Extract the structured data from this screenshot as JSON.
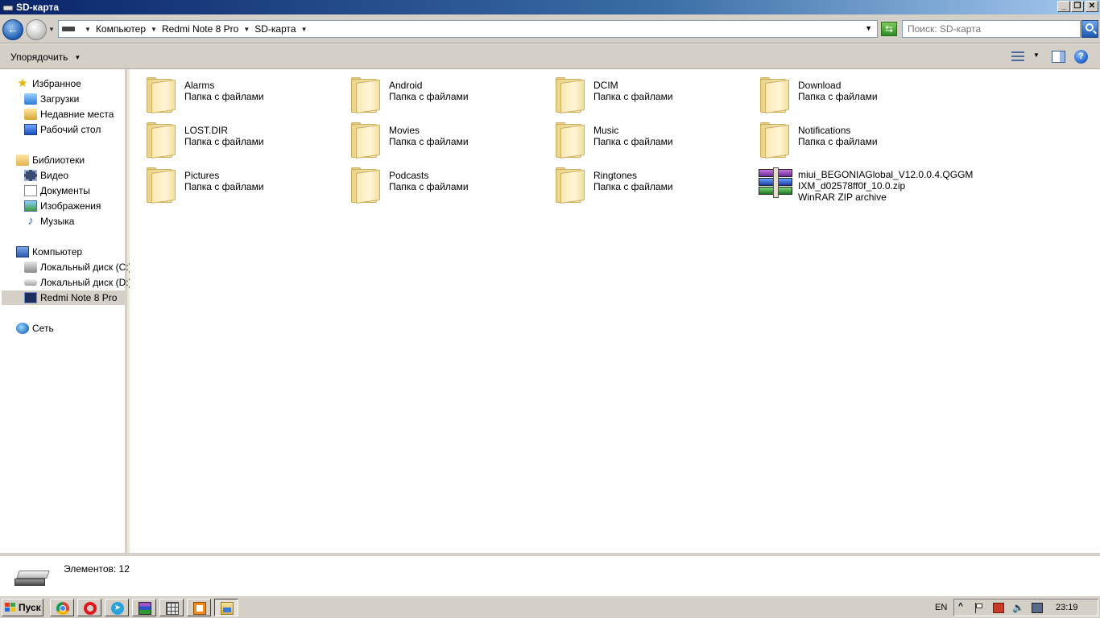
{
  "window": {
    "title": "SD-карта",
    "controls": {
      "minimize": "_",
      "restore": "❐",
      "close": "✕"
    }
  },
  "address": {
    "breadcrumbs": [
      "Компьютер",
      "Redmi Note 8 Pro",
      "SD-карта"
    ],
    "search_placeholder": "Поиск: SD-карта"
  },
  "toolbar": {
    "organize_label": "Упорядочить",
    "help_glyph": "?"
  },
  "sidebar": {
    "favorites": {
      "label": "Избранное",
      "items": [
        "Загрузки",
        "Недавние места",
        "Рабочий стол"
      ]
    },
    "libraries": {
      "label": "Библиотеки",
      "items": [
        "Видео",
        "Документы",
        "Изображения",
        "Музыка"
      ]
    },
    "computer": {
      "label": "Компьютер",
      "items": [
        "Локальный диск (C:)",
        "Локальный диск (D:)",
        "Redmi Note 8 Pro"
      ],
      "selected": "Redmi Note 8 Pro"
    },
    "network": {
      "label": "Сеть"
    }
  },
  "items": [
    {
      "name": "Alarms",
      "type": "Папка с файлами"
    },
    {
      "name": "Android",
      "type": "Папка с файлами"
    },
    {
      "name": "DCIM",
      "type": "Папка с файлами"
    },
    {
      "name": "Download",
      "type": "Папка с файлами"
    },
    {
      "name": "LOST.DIR",
      "type": "Папка с файлами"
    },
    {
      "name": "Movies",
      "type": "Папка с файлами"
    },
    {
      "name": "Music",
      "type": "Папка с файлами"
    },
    {
      "name": "Notifications",
      "type": "Папка с файлами"
    },
    {
      "name": "Pictures",
      "type": "Папка с файлами"
    },
    {
      "name": "Podcasts",
      "type": "Папка с файлами"
    },
    {
      "name": "Ringtones",
      "type": "Папка с файлами"
    },
    {
      "name_line1": "miui_BEGONIAGlobal_V12.0.0.4.QGGM",
      "name_line2": "IXM_d02578ff0f_10.0.zip",
      "type": "WinRAR ZIP archive"
    }
  ],
  "details": {
    "count_label": "Элементов: 12"
  },
  "taskbar": {
    "start_label": "Пуск",
    "apps": [
      "chrome-icon",
      "opera-icon",
      "telegram-icon",
      "winrar-icon",
      "calculator-icon",
      "app-icon",
      "explorer-icon"
    ],
    "language": "EN",
    "tray_up": "^",
    "clock": "23:19"
  },
  "colors": {
    "titlebar": "#0a246a",
    "face": "#d4d0c8",
    "folder": "#f4e3a6"
  }
}
